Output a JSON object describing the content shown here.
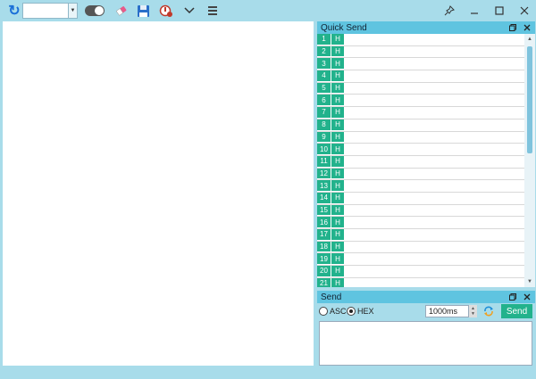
{
  "toolbar": {
    "refresh_icon": "refresh-icon",
    "port_value": "",
    "icons": [
      "refresh-icon",
      "toggle-switch",
      "eraser-icon",
      "save-icon",
      "record-icon",
      "chevron-down-icon",
      "hamburger-menu-icon"
    ]
  },
  "window": {
    "pin_icon": "pin-icon",
    "minimize_icon": "minimize-icon",
    "maximize_icon": "maximize-icon",
    "close_icon": "close-icon"
  },
  "quick_send": {
    "title": "Quick Send",
    "rows": [
      {
        "num": "1",
        "mode": "H"
      },
      {
        "num": "2",
        "mode": "H"
      },
      {
        "num": "3",
        "mode": "H"
      },
      {
        "num": "4",
        "mode": "H"
      },
      {
        "num": "5",
        "mode": "H"
      },
      {
        "num": "6",
        "mode": "H"
      },
      {
        "num": "7",
        "mode": "H"
      },
      {
        "num": "8",
        "mode": "H"
      },
      {
        "num": "9",
        "mode": "H"
      },
      {
        "num": "10",
        "mode": "H"
      },
      {
        "num": "11",
        "mode": "H"
      },
      {
        "num": "12",
        "mode": "H"
      },
      {
        "num": "13",
        "mode": "H"
      },
      {
        "num": "14",
        "mode": "H"
      },
      {
        "num": "15",
        "mode": "H"
      },
      {
        "num": "16",
        "mode": "H"
      },
      {
        "num": "17",
        "mode": "H"
      },
      {
        "num": "18",
        "mode": "H"
      },
      {
        "num": "19",
        "mode": "H"
      },
      {
        "num": "20",
        "mode": "H"
      },
      {
        "num": "21",
        "mode": "H"
      }
    ]
  },
  "send": {
    "title": "Send",
    "asc_label": "ASC",
    "hex_label": "HEX",
    "selected_mode": "HEX",
    "interval": "1000ms",
    "send_label": "Send"
  },
  "colors": {
    "background": "#a8dcea",
    "panel_header": "#5fc4e0",
    "accent": "#22b28c"
  }
}
